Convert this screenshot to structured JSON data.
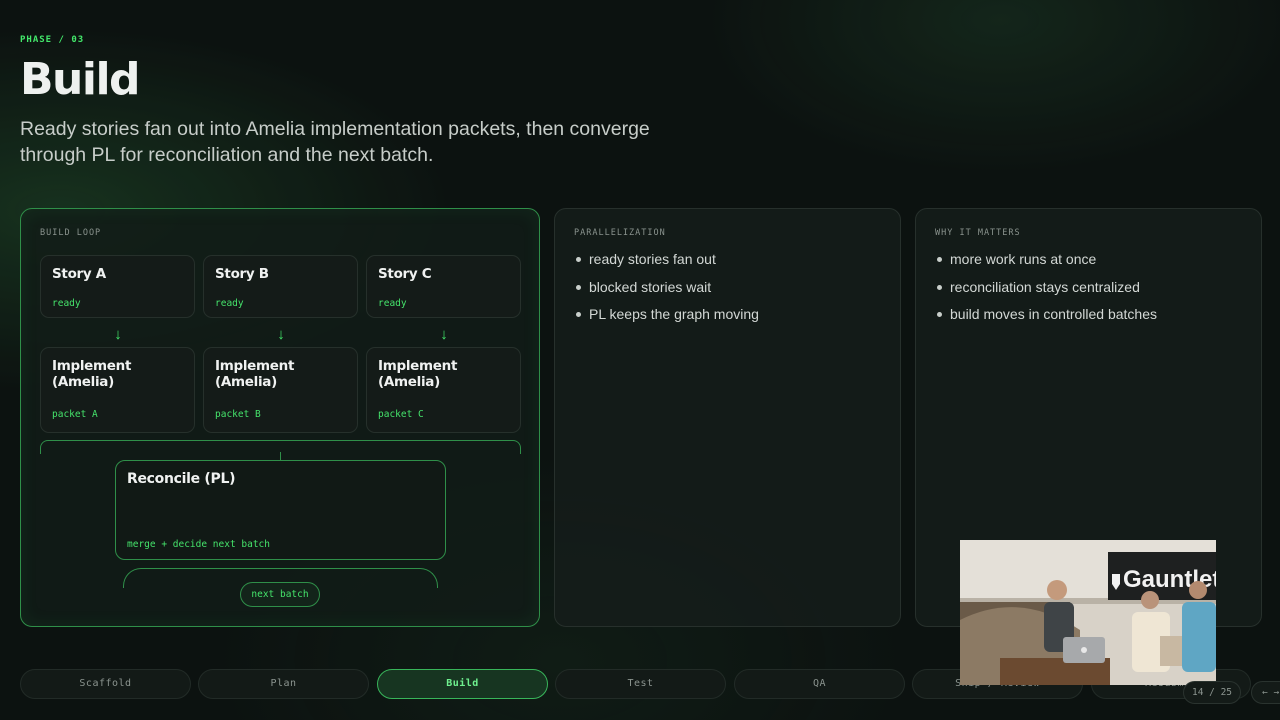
{
  "header": {
    "phase": "PHASE / 03",
    "title": "Build",
    "subtitle": "Ready stories fan out into Amelia implementation packets, then converge through PL for reconciliation and the next batch."
  },
  "build_loop": {
    "label": "BUILD LOOP",
    "stories": [
      {
        "title": "Story A",
        "status": "ready"
      },
      {
        "title": "Story B",
        "status": "ready"
      },
      {
        "title": "Story C",
        "status": "ready"
      }
    ],
    "implements": [
      {
        "title": "Implement (Amelia)",
        "packet": "packet A"
      },
      {
        "title": "Implement (Amelia)",
        "packet": "packet B"
      },
      {
        "title": "Implement (Amelia)",
        "packet": "packet C"
      }
    ],
    "reconcile": {
      "title": "Reconcile (PL)",
      "caption": "merge + decide next batch"
    },
    "next_batch": "next batch"
  },
  "parallelization": {
    "label": "PARALLELIZATION",
    "items": [
      "ready stories fan out",
      "blocked stories wait",
      "PL keeps the graph moving"
    ]
  },
  "why_it_matters": {
    "label": "WHY IT MATTERS",
    "items": [
      "more work runs at once",
      "reconciliation stays centralized",
      "build moves in controlled batches"
    ]
  },
  "nav": {
    "tabs": [
      "Scaffold",
      "Plan",
      "Build",
      "Test",
      "QA",
      "Ship / Review",
      "Resubmit"
    ],
    "active": "Build",
    "counter": "14 / 25",
    "arrows": "← →"
  },
  "video": {
    "sign_text": "Gauntlet"
  },
  "colors": {
    "accent": "#43e86b",
    "border_accent": "#2f8f49",
    "background": "#0c1210"
  }
}
